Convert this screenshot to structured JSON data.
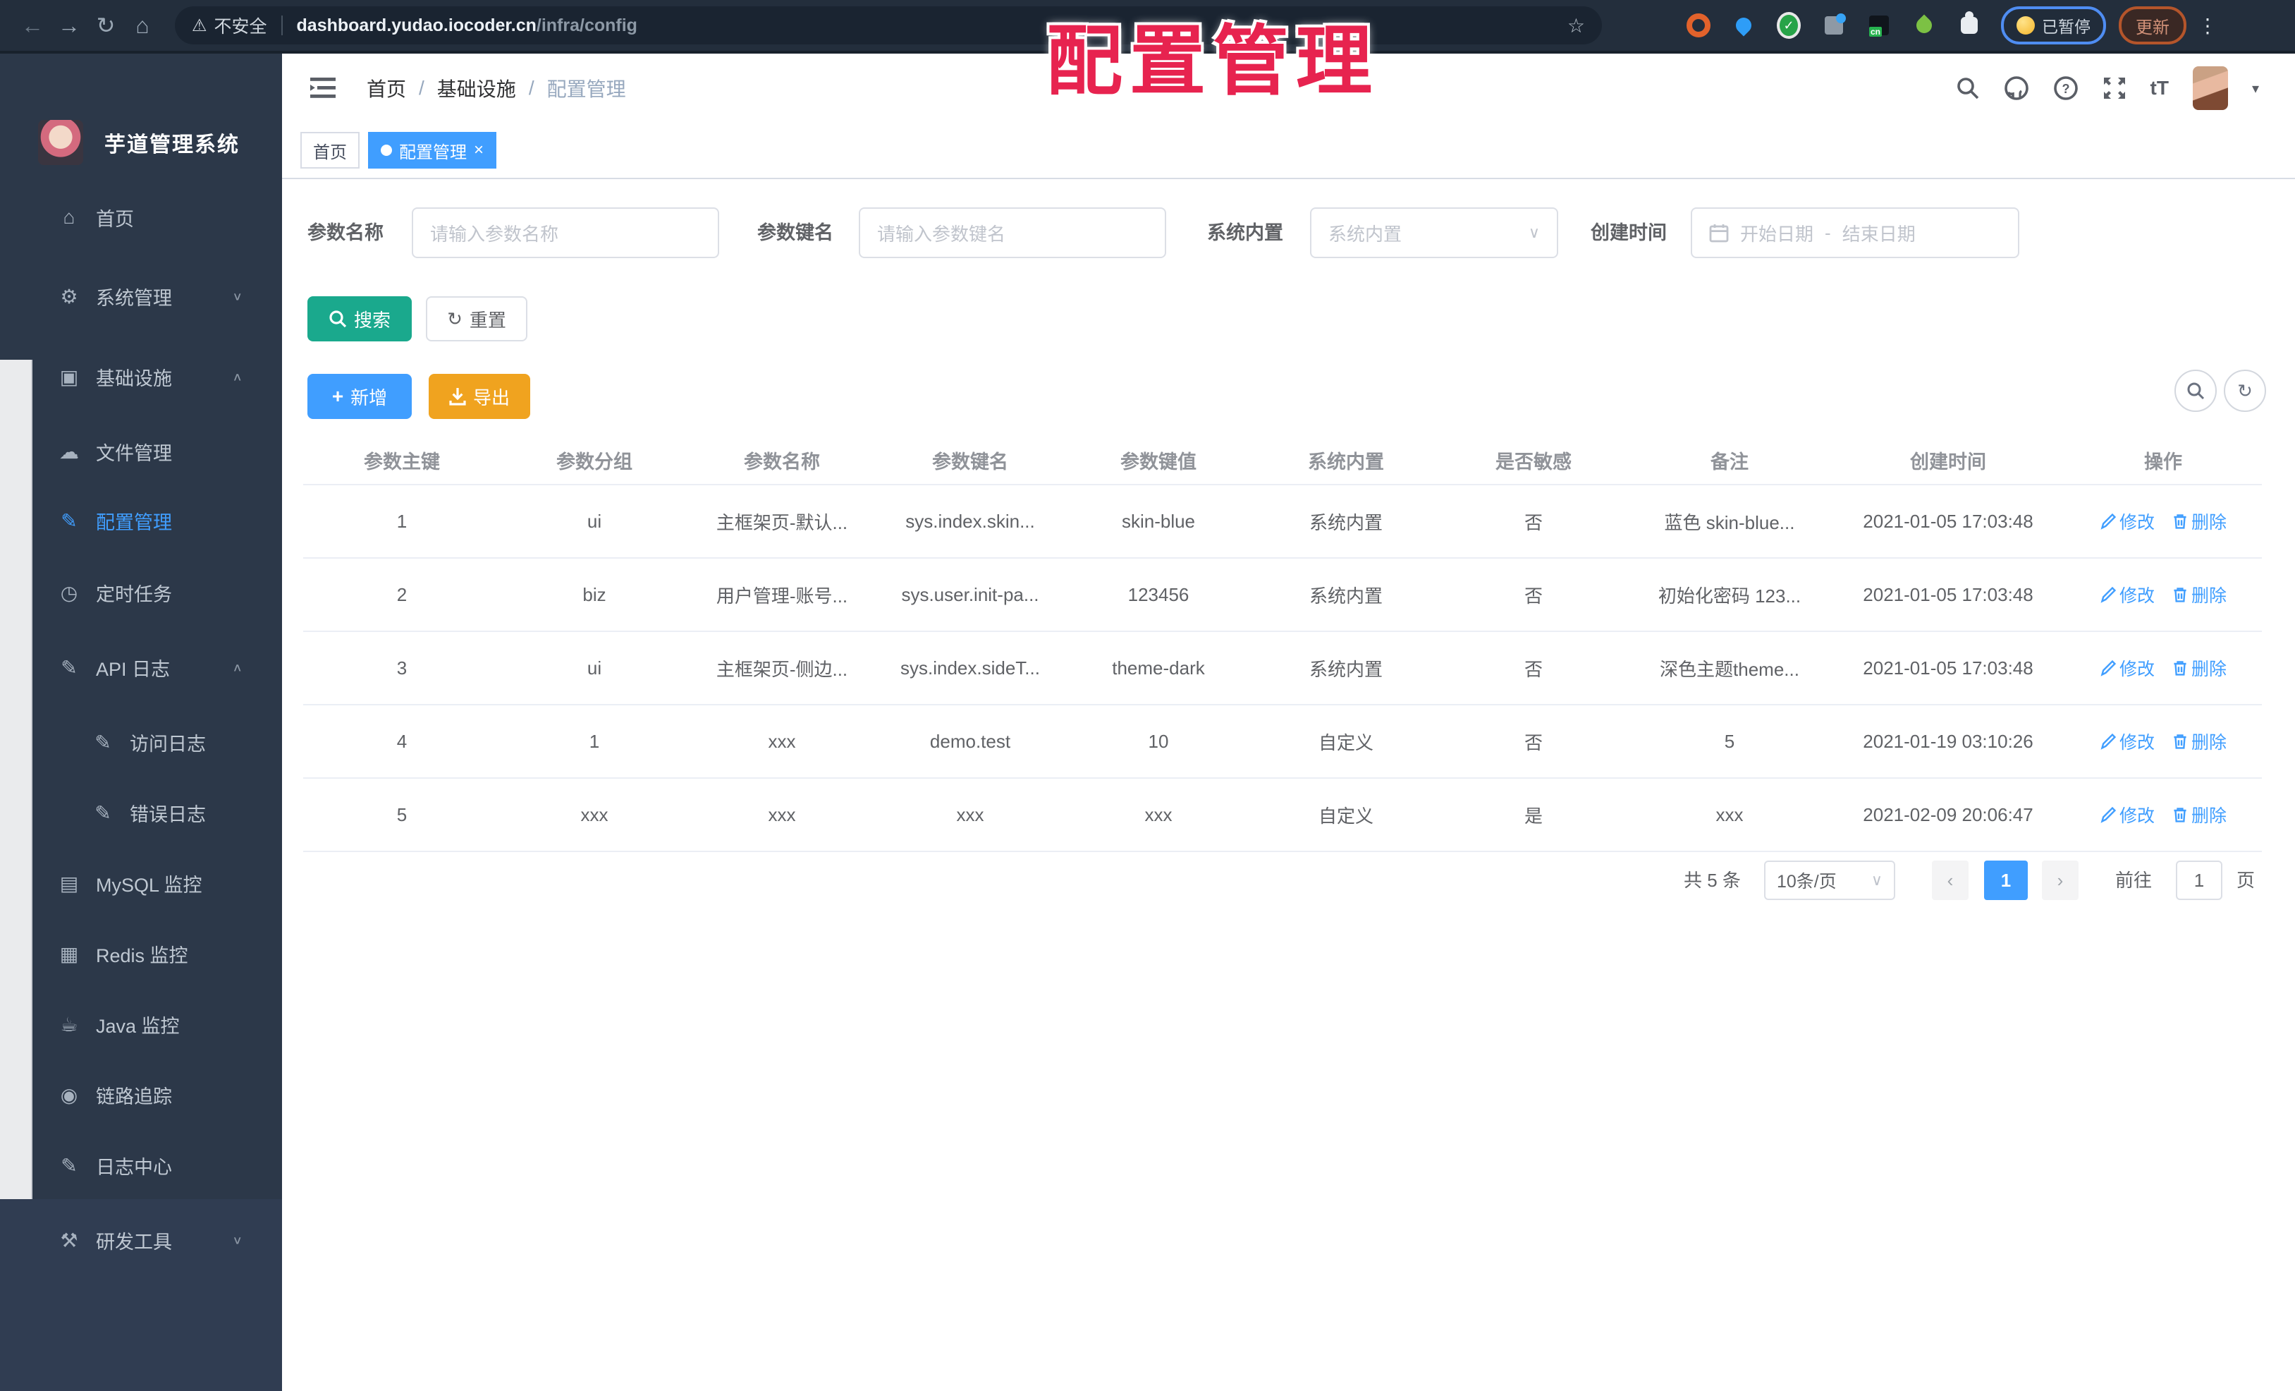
{
  "browser": {
    "security_label": "不安全",
    "url_host": "dashboard.yudao.iocoder.cn",
    "url_path": "/infra/config",
    "paused_badge": "已暂停",
    "update_button": "更新"
  },
  "overlay": {
    "title": "配置管理"
  },
  "sidebar": {
    "app_title": "芋道管理系统",
    "items": [
      {
        "label": "首页",
        "icon": "home-icon"
      },
      {
        "label": "系统管理",
        "icon": "gear-icon"
      },
      {
        "label": "基础设施",
        "icon": "monitor-icon"
      },
      {
        "label": "文件管理",
        "icon": "cloud-icon"
      },
      {
        "label": "配置管理",
        "icon": "edit-square-icon"
      },
      {
        "label": "定时任务",
        "icon": "timer-icon"
      },
      {
        "label": "API 日志",
        "icon": "log-icon"
      },
      {
        "label": "访问日志",
        "icon": "log-icon"
      },
      {
        "label": "错误日志",
        "icon": "log-icon"
      },
      {
        "label": "MySQL 监控",
        "icon": "database-icon"
      },
      {
        "label": "Redis 监控",
        "icon": "redis-icon"
      },
      {
        "label": "Java 监控",
        "icon": "java-icon"
      },
      {
        "label": "链路追踪",
        "icon": "eye-icon"
      },
      {
        "label": "日志中心",
        "icon": "log-icon"
      },
      {
        "label": "研发工具",
        "icon": "tools-icon"
      }
    ]
  },
  "header": {
    "breadcrumb": [
      "首页",
      "基础设施",
      "配置管理"
    ],
    "breadcrumb_separator": "/"
  },
  "tabs": [
    {
      "label": "首页"
    },
    {
      "label": "配置管理"
    }
  ],
  "filters": {
    "name_label": "参数名称",
    "name_placeholder": "请输入参数名称",
    "key_label": "参数键名",
    "key_placeholder": "请输入参数键名",
    "type_label": "系统内置",
    "type_placeholder": "系统内置",
    "date_label": "创建时间",
    "date_start_placeholder": "开始日期",
    "date_separator": "-",
    "date_end_placeholder": "结束日期",
    "search_button": "搜索",
    "reset_button": "重置",
    "add_button": "新增",
    "export_button": "导出"
  },
  "table": {
    "columns": [
      "参数主键",
      "参数分组",
      "参数名称",
      "参数键名",
      "参数键值",
      "系统内置",
      "是否敏感",
      "备注",
      "创建时间",
      "操作"
    ],
    "edit_label": "修改",
    "delete_label": "删除",
    "rows": [
      {
        "cells": [
          "1",
          "ui",
          "主框架页-默认...",
          "sys.index.skin...",
          "skin-blue",
          "系统内置",
          "否",
          "蓝色 skin-blue...",
          "2021-01-05 17:03:48"
        ]
      },
      {
        "cells": [
          "2",
          "biz",
          "用户管理-账号...",
          "sys.user.init-pa...",
          "123456",
          "系统内置",
          "否",
          "初始化密码 123...",
          "2021-01-05 17:03:48"
        ]
      },
      {
        "cells": [
          "3",
          "ui",
          "主框架页-侧边...",
          "sys.index.sideT...",
          "theme-dark",
          "系统内置",
          "否",
          "深色主题theme...",
          "2021-01-05 17:03:48"
        ]
      },
      {
        "cells": [
          "4",
          "1",
          "xxx",
          "demo.test",
          "10",
          "自定义",
          "否",
          "5",
          "2021-01-19 03:10:26"
        ]
      },
      {
        "cells": [
          "5",
          "xxx",
          "xxx",
          "xxx",
          "xxx",
          "自定义",
          "是",
          "xxx",
          "2021-02-09 20:06:47"
        ]
      }
    ]
  },
  "pagination": {
    "total": "共 5 条",
    "page_size": "10条/页",
    "current_page": "1",
    "goto_label": "前往",
    "goto_value": "1",
    "page_label": "页"
  },
  "colors": {
    "accent": "#409eff",
    "search_teal": "#1aa98d",
    "export_orange": "#f0a31f",
    "annotation_red": "#e7234f",
    "sidebar_bg": "#2c3849",
    "browser_bar_bg": "#232e3c"
  }
}
